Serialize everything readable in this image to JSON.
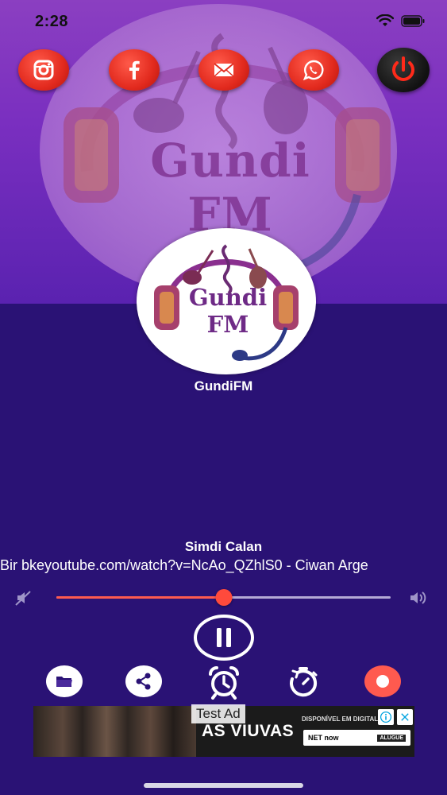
{
  "status_bar": {
    "time": "2:28"
  },
  "header": {
    "background_logo_text": "Gundi FM",
    "social_buttons": [
      {
        "name": "instagram",
        "icon": "instagram-icon"
      },
      {
        "name": "facebook",
        "icon": "facebook-icon",
        "glyph": "f"
      },
      {
        "name": "email",
        "icon": "mail-icon"
      },
      {
        "name": "whatsapp",
        "icon": "whatsapp-icon"
      }
    ],
    "power_icon": "power-icon"
  },
  "station": {
    "logo_text": "Gundi FM",
    "name": "GundiFM"
  },
  "now_playing": {
    "status": "Simdi Calan",
    "track": "Bir bkeyoutube.com/watch?v=NcAo_QZhlS0 - Ciwan Arge"
  },
  "volume": {
    "level": 0.5
  },
  "toolbar": {
    "items": [
      "folder-icon",
      "share-icon",
      "alarm-icon",
      "timer-icon",
      "record-icon"
    ]
  },
  "ad": {
    "label": "Test Ad",
    "title": "AS VIUVAS",
    "available_text": "DISPONÍVEL EM DIGITAL",
    "partner_text": "NET now",
    "rent_text": "ALUGUE"
  },
  "colors": {
    "accent": "#ff4a3c",
    "background": "#2a1275",
    "header_top": "#8b3fc1"
  }
}
